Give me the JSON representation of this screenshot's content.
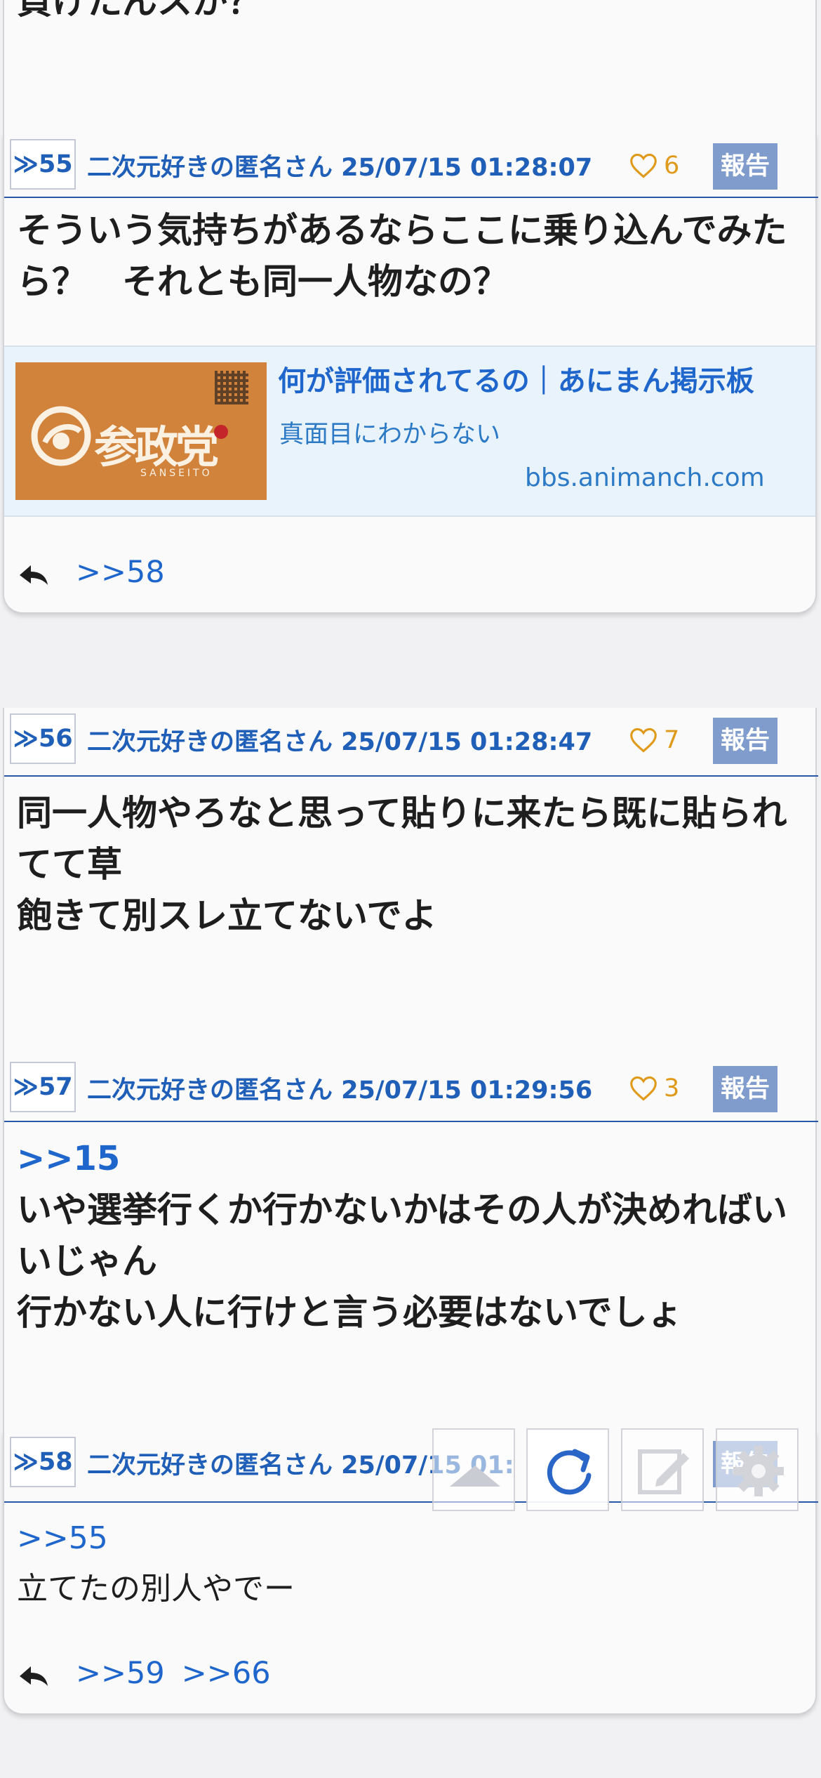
{
  "top_partial": {
    "text": "負けたんスか？"
  },
  "posts": [
    {
      "num": "55",
      "author": "二次元好きの匿名さん 25/07/15 01:28:07",
      "likes": "6",
      "report": "報告",
      "body": [
        "そういう気持ちがあるならここに乗り込んでみたら？　それとも同一人物なの？"
      ],
      "link_preview": {
        "title": "何が評価されてるの｜あにまん掲示板",
        "description": "真面目にわからない",
        "domain": "bbs.animanch.com",
        "thumb_text": "参政党",
        "thumb_sub": "SANSEITO"
      },
      "replies": [
        ">>58"
      ]
    },
    {
      "num": "56",
      "author": "二次元好きの匿名さん 25/07/15 01:28:47",
      "likes": "7",
      "report": "報告",
      "body": [
        "同一人物やろなと思って貼りに来たら既に貼られてて草",
        "飽きて別スレ立てないでよ"
      ]
    },
    {
      "num": "57",
      "author": "二次元好きの匿名さん 25/07/15 01:29:56",
      "likes": "3",
      "report": "報告",
      "anchor": ">>15",
      "body": [
        "いや選挙行くか行かないかはその人が決めればいいじゃん",
        "行かない人に行けと言う必要はないでしょ"
      ]
    },
    {
      "num": "58",
      "author": "二次元好きの匿名さん 25/07/15 01:",
      "likes": "",
      "report": "報告",
      "anchor": ">>55",
      "body": [
        "立てたの別人やでー"
      ],
      "replies": [
        ">>59",
        ">>66"
      ]
    }
  ],
  "float_toolbar": [
    "scroll-top-icon",
    "refresh-icon",
    "write-icon",
    "settings-icon"
  ],
  "colors": {
    "accent": "#1f5fb8",
    "link": "#1f66cc",
    "like": "#e09a1a",
    "report_bg": "#7f9ccd"
  }
}
